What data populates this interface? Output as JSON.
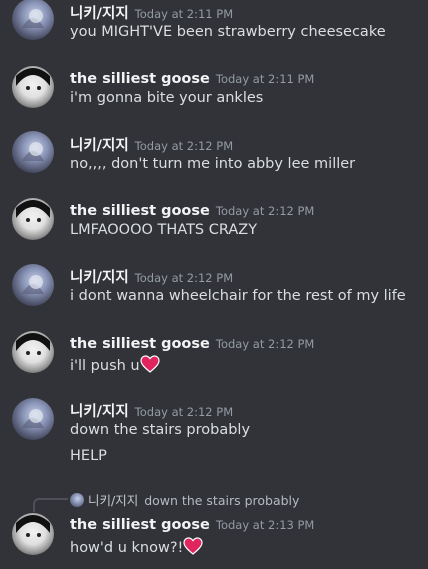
{
  "messages": [
    {
      "user": "니키/지지",
      "time": "Today at 2:11 PM",
      "lines": [
        "you MIGHT'VE been strawberry cheesecake"
      ]
    },
    {
      "user": "the silliest goose",
      "time": "Today at 2:11 PM",
      "lines": [
        "i'm gonna bite your ankles"
      ]
    },
    {
      "user": "니키/지지",
      "time": "Today at 2:12 PM",
      "lines": [
        "no,,,, don't turn me into abby lee miller"
      ]
    },
    {
      "user": "the silliest goose",
      "time": "Today at 2:12 PM",
      "lines": [
        "LMFAOOOO THATS CRAZY"
      ]
    },
    {
      "user": "니키/지지",
      "time": "Today at 2:12 PM",
      "lines": [
        "i dont wanna wheelchair for the rest of my life"
      ]
    },
    {
      "user": "the silliest goose",
      "time": "Today at 2:12 PM",
      "lines": [
        "i'll push u"
      ]
    },
    {
      "user": "니키/지지",
      "time": "Today at 2:12 PM",
      "lines": [
        "down the stairs probably",
        "HELP"
      ]
    },
    {
      "user": "the silliest goose",
      "time": "Today at 2:13 PM",
      "lines": [
        "how'd u know?!"
      ]
    }
  ],
  "reply": {
    "user": "니키/지지",
    "text": "down the stairs probably"
  },
  "icons": {
    "heart": "heart-emoji",
    "niki_avatar": "avatar-niki",
    "goose_avatar": "avatar-goose"
  },
  "colors": {
    "background": "#313338",
    "heart": "#e0245e"
  }
}
